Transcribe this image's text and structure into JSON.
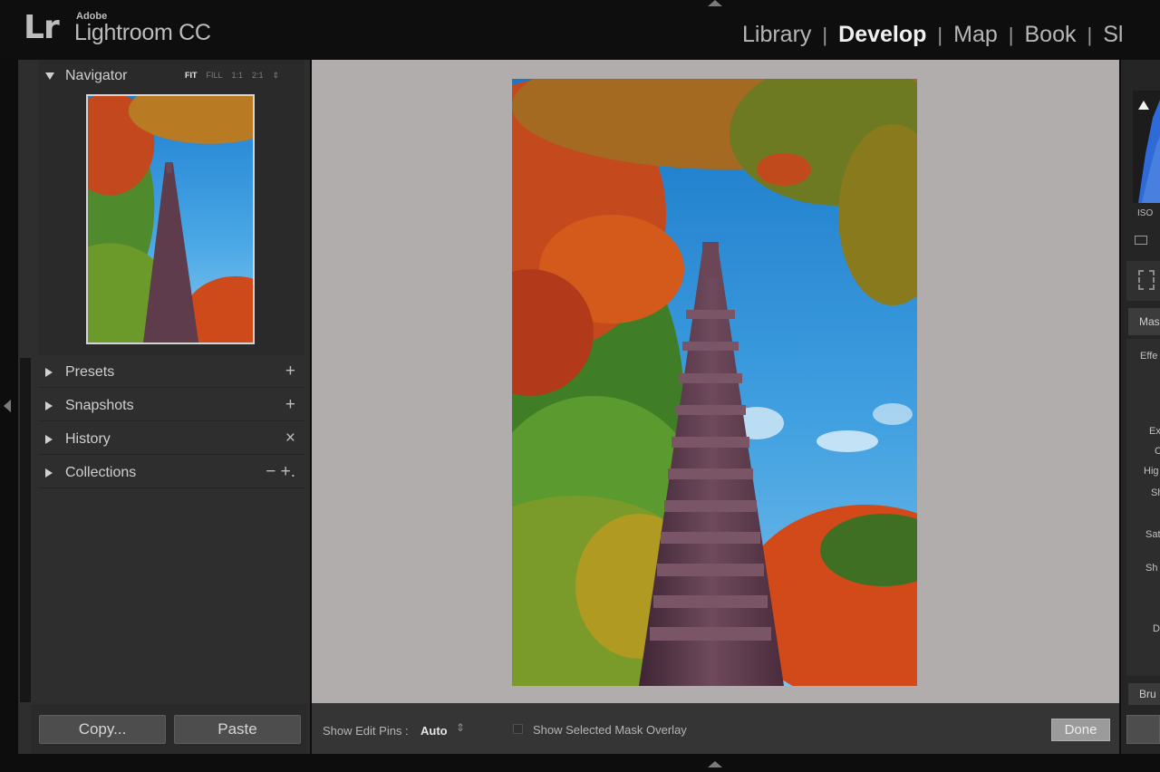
{
  "app": {
    "logo": "Lr",
    "brand_top": "Adobe",
    "brand_name": "Lightroom CC"
  },
  "modules": {
    "library": "Library",
    "develop": "Develop",
    "map": "Map",
    "book": "Book",
    "slideshow_partial": "Sl",
    "separator": "|",
    "active": "Develop"
  },
  "navigator": {
    "title": "Navigator",
    "zoom_fit": "FIT",
    "zoom_fill": "FILL",
    "zoom_1_1": "1:1",
    "zoom_2_1": "2:1",
    "zoom_stepper": "⇕",
    "active_zoom": "FIT"
  },
  "left_sections": [
    {
      "label": "Presets",
      "action": "+"
    },
    {
      "label": "Snapshots",
      "action": "+"
    },
    {
      "label": "History",
      "action": "×"
    },
    {
      "label": "Collections",
      "action": "− +."
    }
  ],
  "footer": {
    "copy": "Copy...",
    "paste": "Paste"
  },
  "toolbar": {
    "edit_pins_label": "Show Edit Pins :",
    "edit_pins_value": "Auto",
    "edit_pins_stepper": "⇕",
    "mask_overlay_label": "Show Selected Mask Overlay",
    "mask_overlay_checked": false,
    "done": "Done"
  },
  "right_panel": {
    "hist_info": "ISO",
    "mask_tab_partial": "Mas",
    "effect_partial": "Effe",
    "labels_partial": [
      "Ex",
      "C",
      "Hig",
      "Sh",
      "Sat",
      "Sh",
      "D"
    ],
    "brush_partial": "Bru"
  },
  "colors": {
    "background": "#0d0d0d",
    "panel": "#2e2e2e",
    "canvas": "#b2adad",
    "sky": "#3a9ad8",
    "pagoda": "#5a3a48",
    "maple_red": "#c8421c",
    "foliage_green": "#4b8a2a"
  }
}
